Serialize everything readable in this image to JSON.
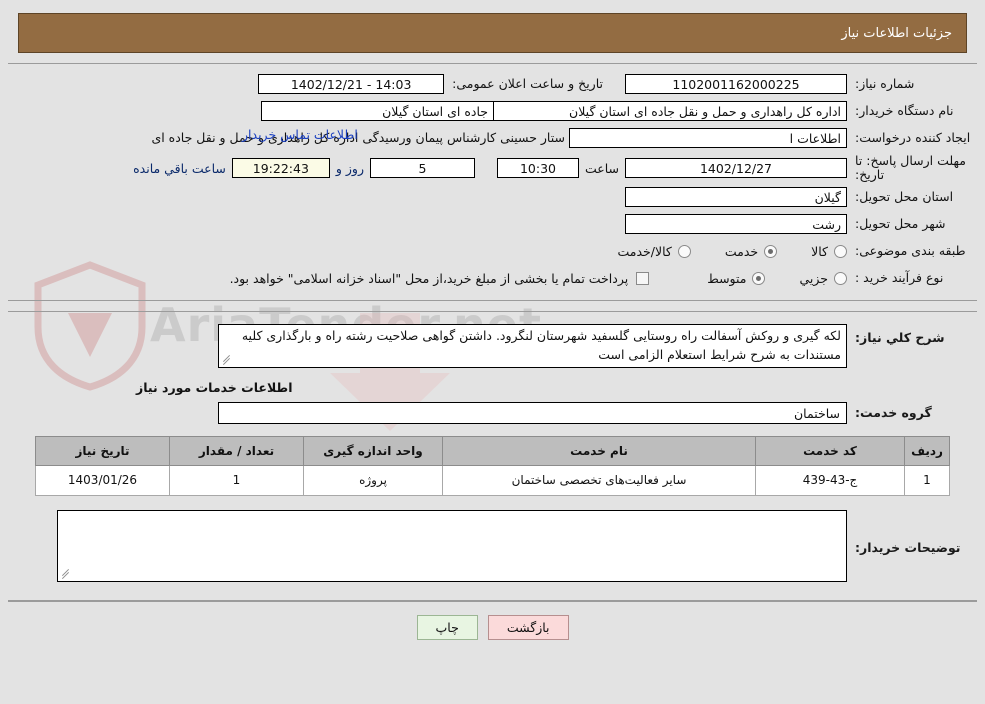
{
  "header": {
    "title": "جزئیات اطلاعات نیاز"
  },
  "fields": {
    "need_number_label": "شماره نیاز:",
    "need_number_value": "1102001162000225",
    "announce_label": "تاریخ و ساعت اعلان عمومی:",
    "announce_value": "14:03 - 1402/12/21",
    "buyer_org_label": "نام دستگاه خریدار:",
    "buyer_org_value_right": "اداره کل راهداری و حمل و نقل جاده ای استان گیلان",
    "buyer_org_value_left": "جاده ای استان گیلان",
    "creator_label": "ایجاد کننده درخواست:",
    "creator_value": "ستار حسینی کارشناس پیمان ورسیدگی اداره کل راهداری و حمل و نقل جاده ای",
    "creator_value_box": "اطلاعات ا",
    "contact_link": "اطلاعات تماس خریدار",
    "deadline_label": "مهلت ارسال پاسخ: تا تاریخ:",
    "deadline_date": "1402/12/27",
    "clock_label": "ساعت",
    "clock_value": "10:30",
    "days_value": "5",
    "days_sep": "روز و",
    "timer_value": "19:22:43",
    "timer_suffix": "ساعت باقي مانده",
    "province_label": "استان محل تحویل:",
    "province_value": "گیلان",
    "city_label": "شهر محل تحویل:",
    "city_value": "رشت",
    "classification_label": "طبقه بندی موضوعی:",
    "classification_options": [
      {
        "label": "کالا",
        "selected": false
      },
      {
        "label": "خدمت",
        "selected": true
      },
      {
        "label": "کالا/خدمت",
        "selected": false
      }
    ],
    "process_label": "نوع فرآیند خرید :",
    "process_options": [
      {
        "label": "جزیي",
        "selected": false
      },
      {
        "label": "متوسط",
        "selected": true
      }
    ],
    "treasury_checkbox_label": "پرداخت تمام یا بخشی از مبلغ خرید،از محل \"اسناد خزانه اسلامی\" خواهد بود.",
    "treasury_checked": false
  },
  "description": {
    "label": "شرح کلي نیاز:",
    "value": "لکه گیری و روکش آسفالت راه روستایی گلسفید شهرستان لنگرود. داشتن گواهی صلاحیت رشته راه و بارگذاری کلیه مستندات به شرح شرایط استعلام الزامی است"
  },
  "services_section": {
    "title": "اطلاعات خدمات مورد نیاز",
    "group_label": "گروه خدمت:",
    "group_value": "ساختمان"
  },
  "table": {
    "headers": [
      "ردیف",
      "کد خدمت",
      "نام خدمت",
      "واحد اندازه گیری",
      "تعداد / مقدار",
      "تاریخ نیاز"
    ],
    "rows": [
      {
        "radif": "1",
        "code": "ج-43-439",
        "name": "سایر فعالیت‌های تخصصی ساختمان",
        "unit": "پروژه",
        "qty": "1",
        "date": "1403/01/26"
      }
    ]
  },
  "buyer_notes": {
    "label": "توضیحات خریدار:",
    "value": ""
  },
  "footer": {
    "print_label": "چاپ",
    "back_label": "بازگشت"
  },
  "watermark": {
    "text": "AriaTender.net"
  },
  "colors": {
    "header_bg": "#936c42",
    "page_bg": "#e3e3e3",
    "link": "#1a3fbf",
    "table_header_bg": "#bdbdbd",
    "timer_bg": "#fbfbe6",
    "back_btn_bg": "#fbdada",
    "print_btn_bg": "#e8f5e2"
  }
}
